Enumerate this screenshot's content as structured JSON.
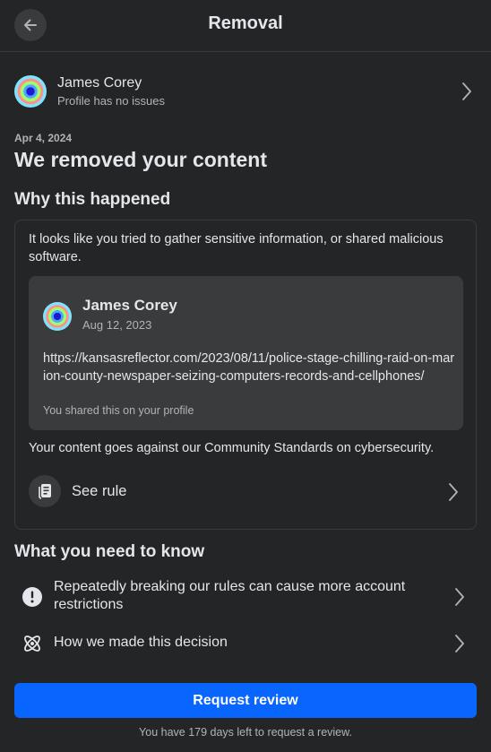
{
  "header": {
    "title": "Removal",
    "back_icon": "arrow-left-icon"
  },
  "profile": {
    "name": "James Corey",
    "status": "Profile has no issues"
  },
  "notice": {
    "date": "Apr 4, 2024",
    "title": "We removed your content"
  },
  "why": {
    "heading": "Why this happened",
    "explanation": "It looks like you tried to gather sensitive information, or shared malicious software.",
    "post": {
      "author": "James Corey",
      "date": "Aug 12, 2023",
      "link": "https://kansasreflector.com/2023/08/11/police-stage-chilling-raid-on-marion-county-newspaper-seizing-computers-records-and-cellphones/",
      "note": "You shared this on your profile"
    },
    "standards": "Your content goes against our Community Standards on cybersecurity.",
    "see_rule": "See rule"
  },
  "know": {
    "heading": "What you need to know",
    "items": [
      {
        "label": "Repeatedly breaking our rules can cause more account restrictions",
        "icon": "exclamation-circle-icon"
      },
      {
        "label": "How we made this decision",
        "icon": "atom-icon"
      }
    ]
  },
  "actions": {
    "request_review": "Request review",
    "footnote": "You have 179 days left to request a review."
  },
  "colors": {
    "background": "#242526",
    "card": "#3a3b3c",
    "accent": "#0866ff",
    "text": "#e4e6eb",
    "muted": "#b0b3b8"
  }
}
